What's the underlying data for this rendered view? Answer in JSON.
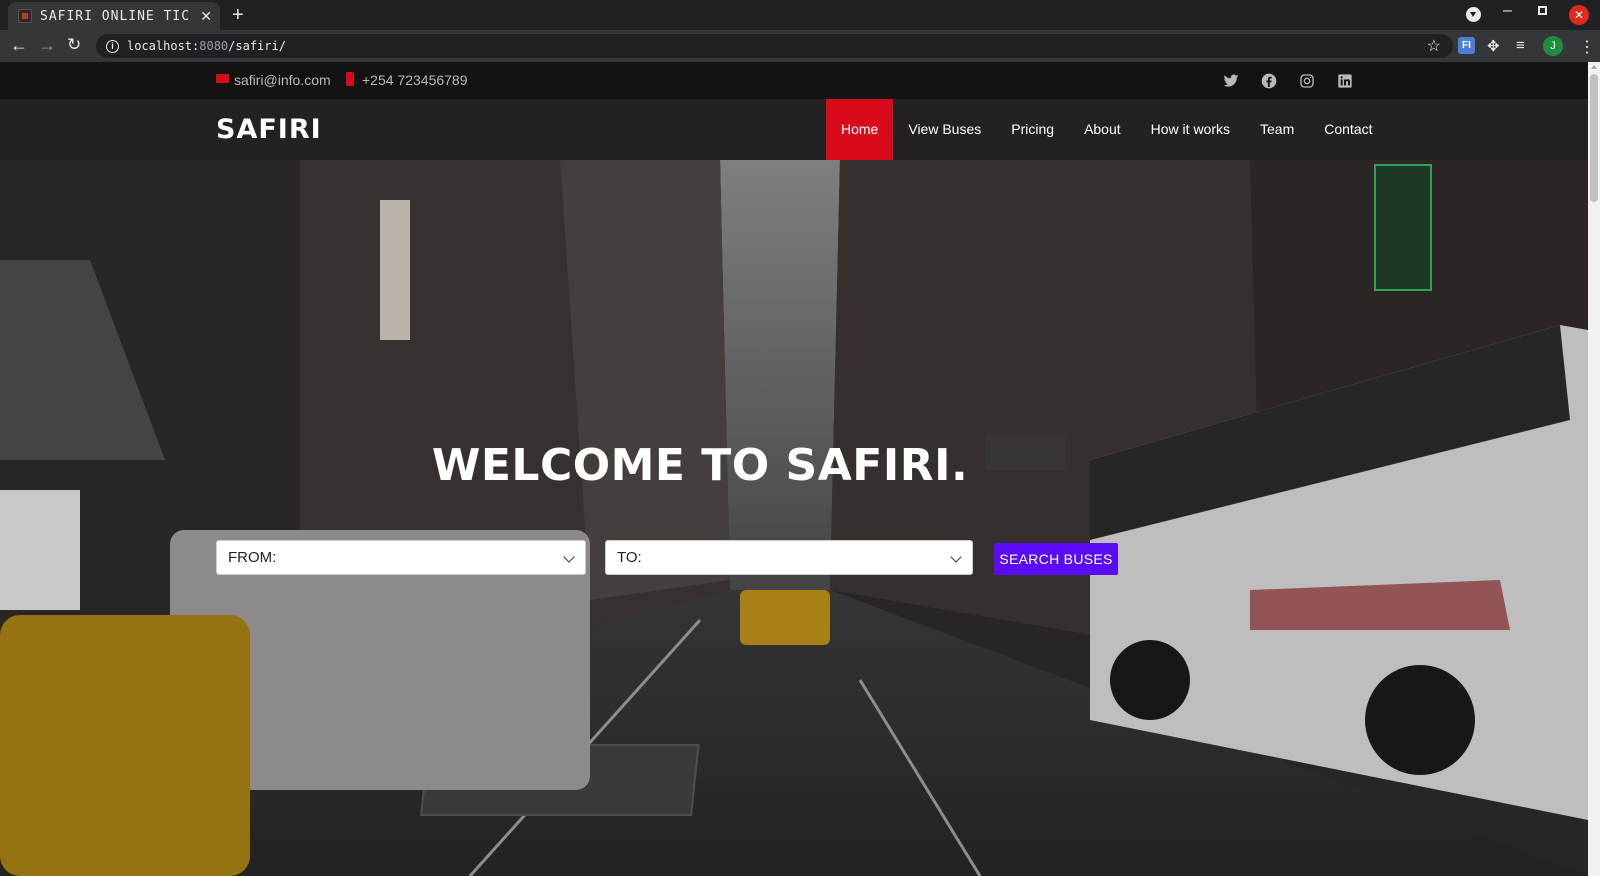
{
  "browser": {
    "tab_title": "SAFIRI ONLINE TIC",
    "url_host": "localhost:",
    "url_port": "8080",
    "url_path": "/safiri/",
    "profile_initial": "J",
    "extension_label": "FI"
  },
  "topbar": {
    "email": "safiri@info.com",
    "phone": "+254 723456789",
    "social": [
      "twitter-icon",
      "facebook-icon",
      "instagram-icon",
      "linkedin-icon"
    ]
  },
  "header": {
    "logo": "SAFIRI",
    "nav": [
      {
        "label": "Home",
        "active": true
      },
      {
        "label": "View Buses"
      },
      {
        "label": "Pricing"
      },
      {
        "label": "About"
      },
      {
        "label": "How it works"
      },
      {
        "label": "Team"
      },
      {
        "label": "Contact"
      }
    ]
  },
  "hero": {
    "title": "WELCOME TO SAFIRI.",
    "from_placeholder": "FROM:",
    "to_placeholder": "TO:",
    "search_label": "SEARCH BUSES"
  },
  "colors": {
    "accent_red": "#d90a1a",
    "button_purple": "#5b0cf6",
    "header_bg": "#222222",
    "topbar_bg": "#131313"
  }
}
